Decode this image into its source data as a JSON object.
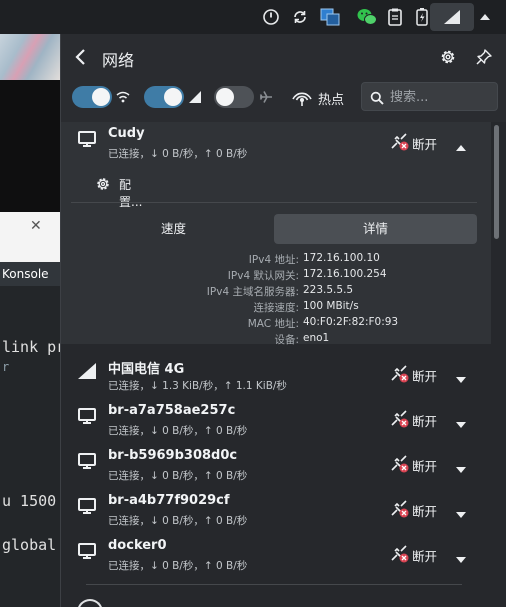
{
  "colors": {
    "toggle_on": "#3f7ca6",
    "toggle_off": "#4e5257",
    "popup_bg": "#2a2c30",
    "list_bg": "#26282c",
    "expanded_bg": "#303337",
    "disconnect_badge": "#da4453"
  },
  "taskbar": {
    "tray_icons": [
      "power-icon",
      "sync-icon",
      "window-switcher-icon",
      "wechat-icon",
      "clipboard-icon",
      "battery-icon",
      "network-icon",
      "expand-tray-icon"
    ]
  },
  "background": {
    "window_close": "✕",
    "konsole_tab": "Konsole",
    "terminal_lines": [
      "link pr",
      "r",
      "u 1500",
      "global"
    ]
  },
  "header": {
    "title": "网络",
    "back_icon": "back-arrow-icon",
    "settings_icon": "gear-icon",
    "pin_icon": "pin-icon"
  },
  "controls": {
    "wired_toggle": "on",
    "wifi_toggle": "on",
    "airplane_toggle": "off",
    "hotspot_label": "热点",
    "search_placeholder": "搜索..."
  },
  "connections": [
    {
      "name": "Cudy",
      "status": "已连接，↓ 0 B/秒，↑ 0 B/秒",
      "icon": "wired-monitor-icon",
      "action": "断开",
      "expanded": true,
      "config_label": "配置...",
      "tabs": [
        "速度",
        "详情"
      ],
      "active_tab": "详情",
      "details": [
        {
          "label": "IPv4 地址:",
          "value": "172.16.100.10"
        },
        {
          "label": "IPv4 默认网关:",
          "value": "172.16.100.254"
        },
        {
          "label": "IPv4 主域名服务器:",
          "value": "223.5.5.5"
        },
        {
          "label": "连接速度:",
          "value": "100 MBit/s"
        },
        {
          "label": "MAC 地址:",
          "value": "40:F0:2F:82:F0:93"
        },
        {
          "label": "设备:",
          "value": "eno1"
        }
      ]
    },
    {
      "name": "中国电信 4G",
      "status": "已连接，↓ 1.3 KiB/秒，↑ 1.1 KiB/秒",
      "icon": "cellular-signal-icon",
      "action": "断开"
    },
    {
      "name": "br-a7a758ae257c",
      "status": "已连接，↓ 0 B/秒，↑ 0 B/秒",
      "icon": "wired-monitor-icon",
      "action": "断开"
    },
    {
      "name": "br-b5969b308d0c",
      "status": "已连接，↓ 0 B/秒，↑ 0 B/秒",
      "icon": "wired-monitor-icon",
      "action": "断开"
    },
    {
      "name": "br-a4b77f9029cf",
      "status": "已连接，↓ 0 B/秒，↑ 0 B/秒",
      "icon": "wired-monitor-icon",
      "action": "断开"
    },
    {
      "name": "docker0",
      "status": "已连接，↓ 0 B/秒，↑ 0 B/秒",
      "icon": "wired-monitor-icon",
      "action": "断开"
    }
  ]
}
